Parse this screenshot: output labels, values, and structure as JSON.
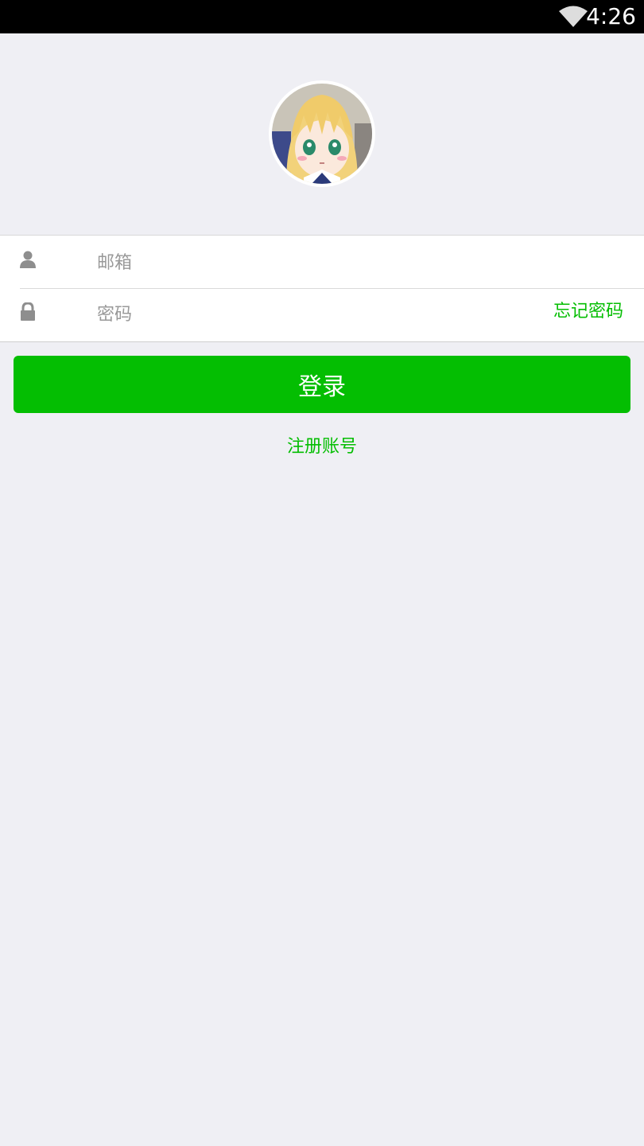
{
  "status_bar": {
    "time": "4:26",
    "wifi_icon": "wifi-icon"
  },
  "avatar": {
    "icon": "anime-avatar"
  },
  "login_form": {
    "email_icon": "user-icon",
    "email_placeholder": "邮箱",
    "email_value": "",
    "password_icon": "lock-icon",
    "password_placeholder": "密码",
    "password_value": "",
    "forgot_password": "忘记密码"
  },
  "login_button": "登录",
  "register_link": "注册账号",
  "colors": {
    "accent": "#04be02",
    "background": "#efeff4",
    "status_bar": "#000000"
  }
}
